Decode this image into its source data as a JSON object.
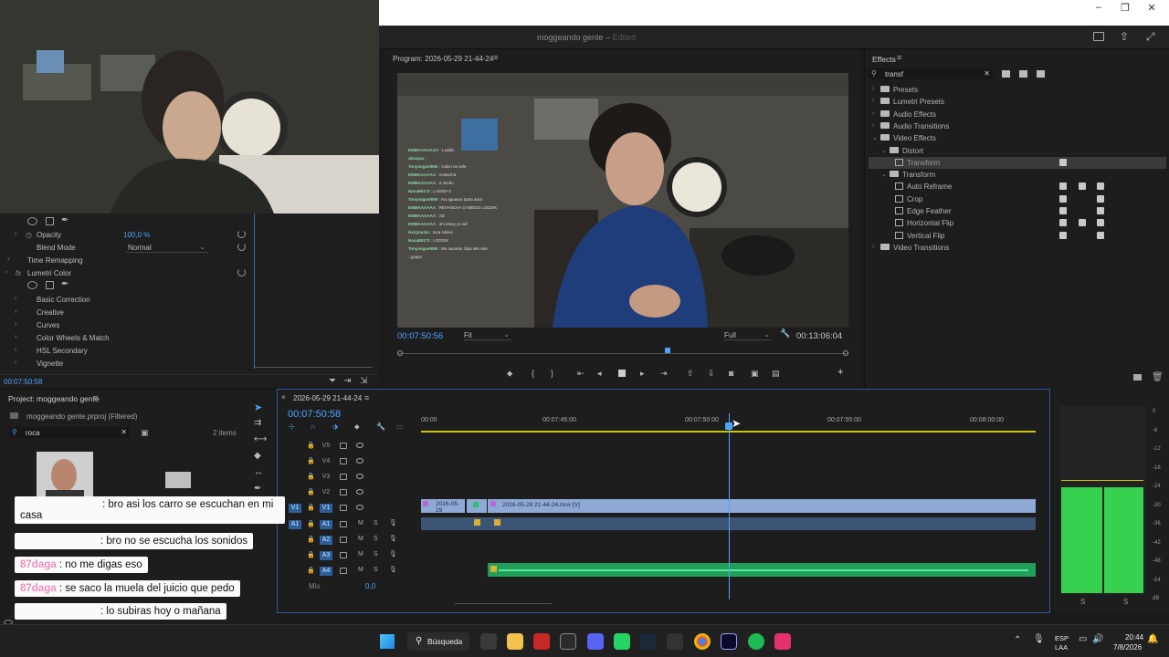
{
  "window": {
    "app_title": "moggeando gente",
    "app_status": "Edited",
    "controls": {
      "minimize": "–",
      "restore": "❐",
      "close": "✕"
    }
  },
  "effect_controls": {
    "opacity": {
      "label": "Opacity",
      "value": "100,0 %"
    },
    "blend_mode": {
      "label": "Blend Mode",
      "value": "Normal"
    },
    "time_remapping": "Time Remapping",
    "lumetri": {
      "label": "Lumetri Color",
      "items": [
        "Basic Correction",
        "Creative",
        "Curves",
        "Color Wheels & Match",
        "HSL Secondary",
        "Vignette"
      ]
    },
    "timecode": "00:07:50:58"
  },
  "program": {
    "title": "Program: 2026-05-29 21-44-24",
    "timecode": "00:07:50:56",
    "zoom": "Fit",
    "resolution": "Full",
    "duration": "00:13:06:04",
    "playhead_fraction": 0.6
  },
  "stream_chat": [
    {
      "user": "EMMAAAAAAA",
      "msg": "Loddix"
    },
    {
      "user": "akuujuu",
      "msg": ""
    },
    {
      "user": "Tonymiguel090",
      "msg": "Calvo no vele"
    },
    {
      "user": "EMMAAAAAA",
      "msg": "revancha"
    },
    {
      "user": "EMMAAAAAA",
      "msg": "a miedo"
    },
    {
      "user": "Nana89173",
      "msg": "LADS0+3"
    },
    {
      "user": "Tonymiguel090",
      "msg": "No aguanto tanta aura"
    },
    {
      "user": "EMMAAAAAA",
      "msg": "REVANCHA O MIEDO LODDIX"
    },
    {
      "user": "EMMAAAAAA",
      "msg": "XD"
    },
    {
      "user": "EMMAAAAAA",
      "msg": "ahi estoy yo wtf"
    },
    {
      "user": "ikorpracko",
      "msg": "toca rabios"
    },
    {
      "user": "Nana89173",
      "msg": "LODDIX"
    },
    {
      "user": "Tonymiguel090",
      "msg": "Me sacaras clips del más"
    },
    {
      "user": "",
      "msg": "guapo"
    }
  ],
  "effects": {
    "title": "Effects",
    "search": "transf",
    "tree": [
      {
        "label": "Presets",
        "type": "folder",
        "level": 0,
        "expanded": false
      },
      {
        "label": "Lumetri Presets",
        "type": "folder",
        "level": 0,
        "expanded": false
      },
      {
        "label": "Audio Effects",
        "type": "folder",
        "level": 0,
        "expanded": false
      },
      {
        "label": "Audio Transitions",
        "type": "folder",
        "level": 0,
        "expanded": false
      },
      {
        "label": "Video Effects",
        "type": "folder",
        "level": 0,
        "expanded": true
      },
      {
        "label": "Distort",
        "type": "folder",
        "level": 1,
        "expanded": true
      },
      {
        "label": "Transform",
        "type": "fx",
        "level": 2,
        "selected": true
      },
      {
        "label": "Transform",
        "type": "folder",
        "level": 1,
        "expanded": true
      },
      {
        "label": "Auto Reframe",
        "type": "fx",
        "level": 2
      },
      {
        "label": "Crop",
        "type": "fx",
        "level": 2
      },
      {
        "label": "Edge Feather",
        "type": "fx",
        "level": 2
      },
      {
        "label": "Horizontal Flip",
        "type": "fx",
        "level": 2
      },
      {
        "label": "Vertical Flip",
        "type": "fx",
        "level": 2
      },
      {
        "label": "Video Transitions",
        "type": "folder",
        "level": 0,
        "expanded": false
      }
    ]
  },
  "project": {
    "title": "Project: moggeando gente",
    "file": "moggeando gente.prproj (Filtered)",
    "search": "roca",
    "count": "2 items"
  },
  "timeline": {
    "tab": "2026-05-29 21-44-24",
    "timecode": "00:07:50:58",
    "ruler": [
      "00:00",
      "00:07:45:00",
      "00:07:50:00",
      "00:07:55:00",
      "00:08:00:00"
    ],
    "video_tracks": [
      "V5",
      "V4",
      "V3",
      "V2",
      "V1"
    ],
    "audio_tracks": [
      "A1",
      "A2",
      "A3",
      "A4"
    ],
    "mix_label": "Mix",
    "mix_value": "0,0",
    "clips": {
      "v1_short": "2026-05-29",
      "v1_main": "2026-05-29 21-44-24.mov [V]"
    }
  },
  "meters": {
    "scale": [
      "0",
      "-6",
      "-12",
      "-18",
      "-24",
      "-30",
      "-36",
      "-42",
      "-48",
      "-54",
      "dB"
    ],
    "solo": [
      "S",
      "S"
    ]
  },
  "overlay_chat": [
    {
      "user": "",
      "msg": ": bro asi los carro se escuchan en mi casa"
    },
    {
      "user": "",
      "msg": ": bro no se escucha los sonidos"
    },
    {
      "user": "87daga",
      "msg": ": no me digas eso"
    },
    {
      "user": "87daga",
      "msg": ": se saco la muela del juicio que pedo"
    },
    {
      "user": "",
      "msg": ": lo subiras hoy o mañana"
    }
  ],
  "taskbar": {
    "search": "Búsqueda",
    "lang": "ESP",
    "region": "LAA",
    "time": "20:44",
    "date": "7/8/2026"
  },
  "colors": {
    "accent": "#2d8ceb",
    "clip_video": "#8fa9d6",
    "clip_audio": "#2fbf71",
    "meter": "#35d14f"
  }
}
